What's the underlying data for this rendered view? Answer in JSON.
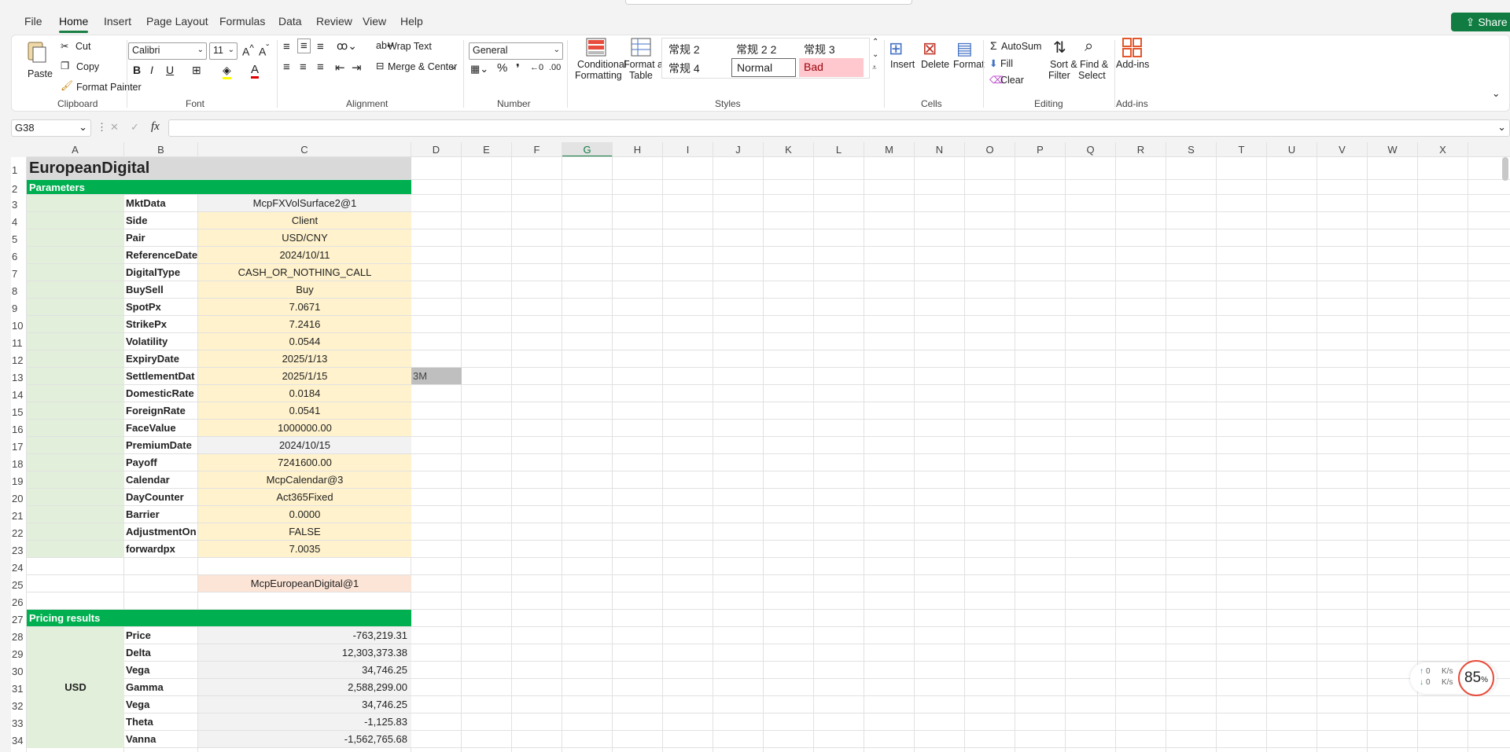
{
  "menu": {
    "tabs": [
      "File",
      "Home",
      "Insert",
      "Page Layout",
      "Formulas",
      "Data",
      "Review",
      "View",
      "Help"
    ],
    "share": "Share"
  },
  "ribbon": {
    "clipboard": {
      "paste": "Paste",
      "cut": "Cut",
      "copy": "Copy",
      "format_painter": "Format Painter",
      "label": "Clipboard"
    },
    "font": {
      "name": "Calibri",
      "size": "11",
      "label": "Font"
    },
    "alignment": {
      "wrap": "Wrap Text",
      "merge": "Merge & Center",
      "label": "Alignment"
    },
    "number": {
      "format": "General",
      "label": "Number"
    },
    "styles": {
      "conditional": "Conditional",
      "formatting": "Formatting",
      "format_as": "Format as",
      "table": "Table",
      "cells": [
        "常规 2",
        "常规 2 2",
        "常规 3",
        "常规 4",
        "Normal",
        "Bad"
      ],
      "label": "Styles"
    },
    "cells": {
      "insert": "Insert",
      "delete": "Delete",
      "format": "Format",
      "label": "Cells"
    },
    "editing": {
      "autosum": "AutoSum",
      "fill": "Fill",
      "clear": "Clear",
      "sort": "Sort &",
      "filter": "Filter",
      "find": "Find &",
      "select": "Select",
      "label": "Editing"
    },
    "addins": {
      "btn": "Add-ins",
      "label": "Add-ins"
    }
  },
  "formula_bar": {
    "name_box": "G38",
    "fx": "fx",
    "value": ""
  },
  "columns": [
    "A",
    "B",
    "C",
    "D",
    "E",
    "F",
    "G",
    "H",
    "I",
    "J",
    "K",
    "L",
    "M",
    "N",
    "O",
    "P",
    "Q",
    "R",
    "S",
    "T",
    "U",
    "V",
    "W",
    "X",
    "Y"
  ],
  "rows": [
    "1",
    "2",
    "3",
    "4",
    "5",
    "6",
    "7",
    "8",
    "9",
    "10",
    "11",
    "12",
    "13",
    "14",
    "15",
    "16",
    "17",
    "18",
    "19",
    "20",
    "21",
    "22",
    "23",
    "24",
    "25",
    "26",
    "27",
    "28",
    "29",
    "30",
    "31",
    "32",
    "33",
    "34"
  ],
  "sheet": {
    "title": "EuropeanDigital",
    "params_header": "Parameters",
    "params": [
      {
        "k": "MktData",
        "v": "McpFXVolSurface2@1",
        "style": "gry"
      },
      {
        "k": "Side",
        "v": "Client",
        "style": "yel"
      },
      {
        "k": "Pair",
        "v": "USD/CNY",
        "style": "yel"
      },
      {
        "k": "ReferenceDate",
        "v": "2024/10/11",
        "style": "yel"
      },
      {
        "k": "DigitalType",
        "v": "CASH_OR_NOTHING_CALL",
        "style": "yel"
      },
      {
        "k": "BuySell",
        "v": "Buy",
        "style": "yel"
      },
      {
        "k": "SpotPx",
        "v": "7.0671",
        "style": "yel"
      },
      {
        "k": "StrikePx",
        "v": "7.2416",
        "style": "yel"
      },
      {
        "k": "Volatility",
        "v": "0.0544",
        "style": "yel"
      },
      {
        "k": "ExpiryDate",
        "v": "2025/1/13",
        "style": "yel"
      },
      {
        "k": "SettlementDat",
        "v": "2025/1/15",
        "style": "yel"
      },
      {
        "k": "DomesticRate",
        "v": "0.0184",
        "style": "yel"
      },
      {
        "k": "ForeignRate",
        "v": "0.0541",
        "style": "yel"
      },
      {
        "k": "FaceValue",
        "v": "1000000.00",
        "style": "yel"
      },
      {
        "k": "PremiumDate",
        "v": "2024/10/15",
        "style": "gry"
      },
      {
        "k": "Payoff",
        "v": "7241600.00",
        "style": "yel"
      },
      {
        "k": "Calendar",
        "v": "McpCalendar@3",
        "style": "yel"
      },
      {
        "k": "DayCounter",
        "v": "Act365Fixed",
        "style": "yel"
      },
      {
        "k": "Barrier",
        "v": "0.0000",
        "style": "yel"
      },
      {
        "k": "AdjustmentOn",
        "v": "FALSE",
        "style": "yel"
      },
      {
        "k": "forwardpx",
        "v": "7.0035",
        "style": "yel"
      }
    ],
    "d13": "3M",
    "object": "McpEuropeanDigital@1",
    "results_header": "Pricing results",
    "currency": "USD",
    "results": [
      {
        "k": "Price",
        "v": "-763,219.31"
      },
      {
        "k": "Delta",
        "v": "12,303,373.38"
      },
      {
        "k": "Vega",
        "v": "34,746.25"
      },
      {
        "k": "Gamma",
        "v": "2,588,299.00"
      },
      {
        "k": "Vega",
        "v": "34,746.25"
      },
      {
        "k": "Theta",
        "v": "-1,125.83"
      },
      {
        "k": "Vanna",
        "v": "-1,562,765.68"
      }
    ]
  },
  "network": {
    "up": "0",
    "down": "0",
    "unit": "K/s",
    "percent": "85",
    "pct": "%"
  }
}
